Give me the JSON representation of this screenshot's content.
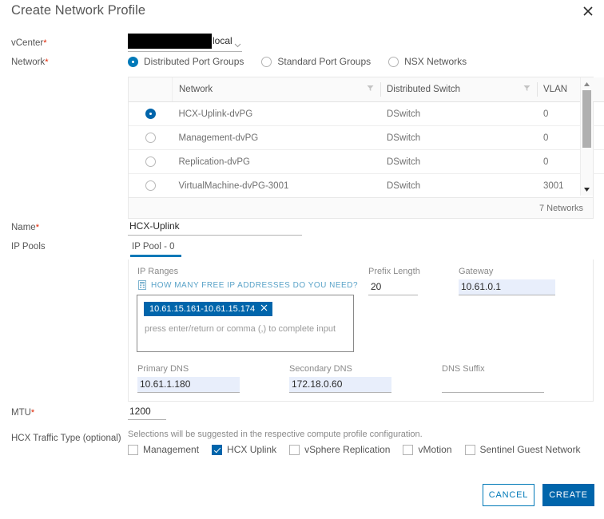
{
  "dialog": {
    "title": "Create Network Profile",
    "close_icon": "close-icon"
  },
  "vcenter": {
    "label": "vCenter",
    "required": "*",
    "redacted_value": "",
    "suffix_text": "local",
    "caret_icon": "chevron-down-icon"
  },
  "network": {
    "label": "Network",
    "required": "*",
    "options": [
      {
        "label": "Distributed Port Groups",
        "selected": true
      },
      {
        "label": "Standard Port Groups",
        "selected": false
      },
      {
        "label": "NSX Networks",
        "selected": false
      }
    ]
  },
  "table": {
    "columns": [
      "Network",
      "Distributed Switch",
      "VLAN"
    ],
    "filter_icon": "filter-icon",
    "rows": [
      {
        "selected": true,
        "network": "HCX-Uplink-dvPG",
        "switch": "DSwitch",
        "vlan": "0"
      },
      {
        "selected": false,
        "network": "Management-dvPG",
        "switch": "DSwitch",
        "vlan": "0"
      },
      {
        "selected": false,
        "network": "Replication-dvPG",
        "switch": "DSwitch",
        "vlan": "0"
      },
      {
        "selected": false,
        "network": "VirtualMachine-dvPG-3001",
        "switch": "DSwitch",
        "vlan": "3001"
      }
    ],
    "footer_count": "7 Networks",
    "scroll_up_icon": "triangle-up-icon",
    "scroll_down_icon": "triangle-down-icon"
  },
  "name": {
    "label": "Name",
    "required": "*",
    "value": "HCX-Uplink",
    "placeholder": ""
  },
  "ip_pools": {
    "label": "IP Pools",
    "tab_label": "IP Pool - 0",
    "ip_ranges_label": "IP Ranges",
    "helper_link": "HOW MANY FREE IP ADDRESSES DO YOU NEED?",
    "helper_icon": "calculator-icon",
    "chip_value": "10.61.15.161-10.61.15.174",
    "chip_remove_icon": "close-icon",
    "chip_hint": "press enter/return or comma (,) to complete input",
    "prefix_length_label": "Prefix Length",
    "prefix_length_value": "20",
    "gateway_label": "Gateway",
    "gateway_value": "10.61.0.1",
    "primary_dns_label": "Primary DNS",
    "primary_dns_value": "10.61.1.180",
    "secondary_dns_label": "Secondary DNS",
    "secondary_dns_value": "172.18.0.60",
    "dns_suffix_label": "DNS Suffix",
    "dns_suffix_value": ""
  },
  "mtu": {
    "label": "MTU",
    "required": "*",
    "value": "1200"
  },
  "traffic_type": {
    "label": "HCX Traffic Type (optional)",
    "note": "Selections will be suggested in the respective compute profile configuration.",
    "options": [
      {
        "label": "Management",
        "checked": false
      },
      {
        "label": "HCX Uplink",
        "checked": true
      },
      {
        "label": "vSphere Replication",
        "checked": false
      },
      {
        "label": "vMotion",
        "checked": false
      },
      {
        "label": "Sentinel Guest Network",
        "checked": false
      }
    ]
  },
  "footer": {
    "cancel_label": "CANCEL",
    "create_label": "CREATE"
  },
  "colors": {
    "accent": "#0079b8",
    "accent_dark": "#0065ab",
    "required_red": "#e02200",
    "autofill_bg": "#e8eefb"
  }
}
